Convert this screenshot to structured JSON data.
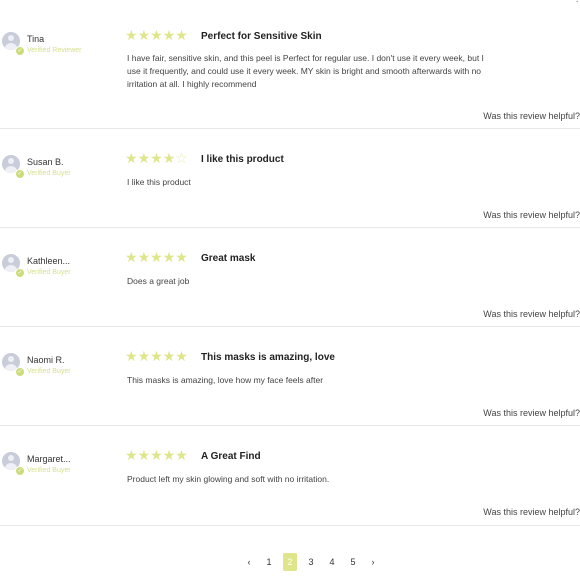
{
  "top_fragment": "?",
  "helpful_label": "Was this review helpful?",
  "reviews": [
    {
      "name": "Tina",
      "badge": "Verified Reviewer",
      "rating": 5,
      "title": "Perfect for Sensitive Skin",
      "body": "I have fair, sensitive skin, and this peel is Perfect for regular use. I don't use it every week, but I use it frequently, and could use it every week. MY skin is bright and smooth afterwards with no irritation at all. I highly recommend"
    },
    {
      "name": "Susan B.",
      "badge": "Verified Buyer",
      "rating": 4,
      "title": "I like this product",
      "body": "I like this product"
    },
    {
      "name": "Kathleen...",
      "badge": "Verified Buyer",
      "rating": 5,
      "title": "Great mask",
      "body": "Does a great job"
    },
    {
      "name": "Naomi R.",
      "badge": "Verified Buyer",
      "rating": 5,
      "title": "This masks is amazing, love",
      "body": "This masks is amazing, love how my face feels after"
    },
    {
      "name": "Margaret...",
      "badge": "Verified Buyer",
      "rating": 5,
      "title": "A Great Find",
      "body": "Product left my skin glowing and soft with no irritation."
    }
  ],
  "pagination": {
    "prev": "‹",
    "next": "›",
    "pages": [
      "1",
      "2",
      "3",
      "4",
      "5"
    ],
    "current": "2"
  },
  "colors": {
    "accent": "#dfe58a",
    "badge": "#d7e08f",
    "divider": "#e8e8e8"
  },
  "icons": {
    "avatar": "user-avatar-icon",
    "verified": "check-circle-icon",
    "star": "star-icon",
    "prev": "chevron-left-icon",
    "next": "chevron-right-icon"
  }
}
